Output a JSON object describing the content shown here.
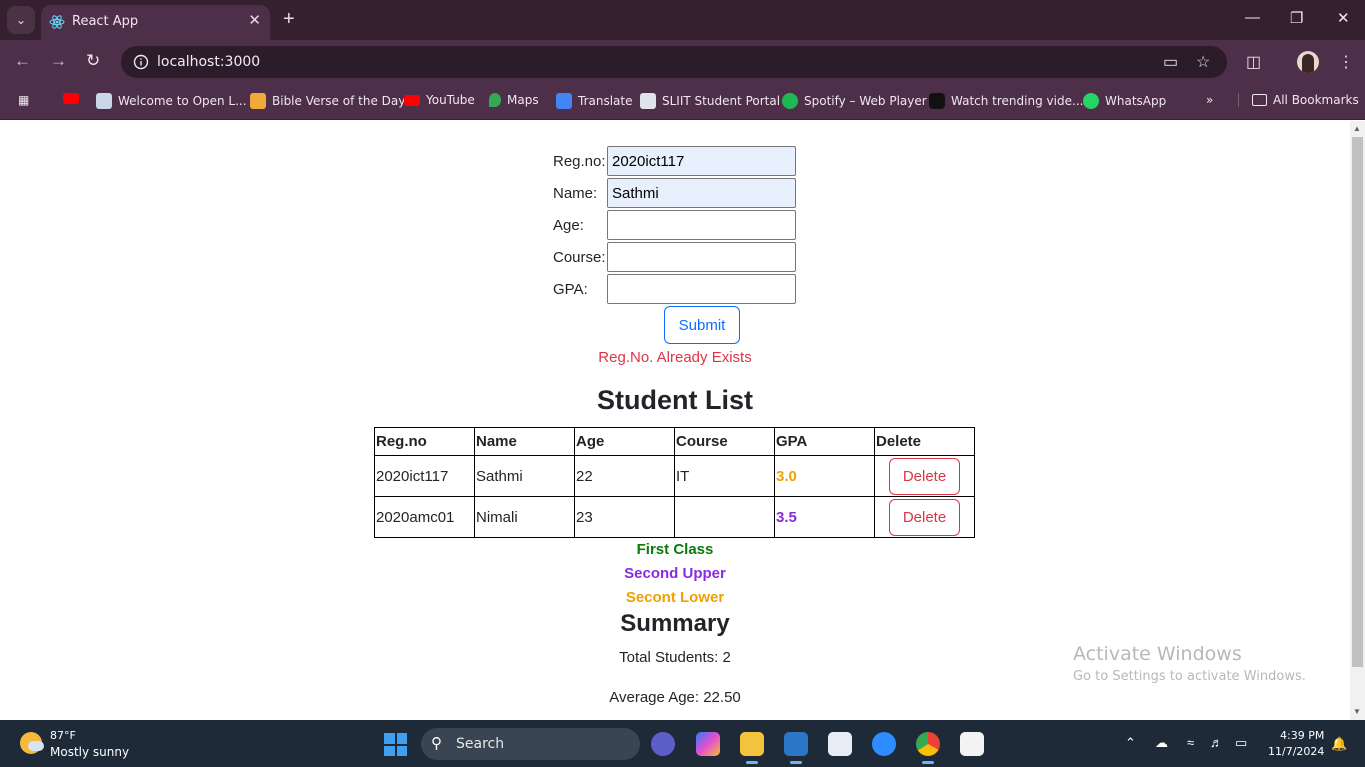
{
  "browser": {
    "tab_title": "React App",
    "url": "localhost:3000",
    "bookmarks": [
      "Welcome to Open L...",
      "Bible Verse of the Day",
      "YouTube",
      "Maps",
      "Translate",
      "SLIIT Student Portal",
      "Spotify – Web Player",
      "Watch trending vide...",
      "WhatsApp"
    ],
    "all_bookmarks": "All Bookmarks"
  },
  "form": {
    "regno_label": "Reg.no:",
    "regno_value": "2020ict117",
    "name_label": "Name:",
    "name_value": "Sathmi",
    "age_label": "Age:",
    "age_value": "",
    "course_label": "Course:",
    "course_value": "",
    "gpa_label": "GPA:",
    "gpa_value": "",
    "submit_label": "Submit",
    "error_message": "Reg.No. Already Exists"
  },
  "student_list": {
    "title": "Student List",
    "columns": [
      "Reg.no",
      "Name",
      "Age",
      "Course",
      "GPA",
      "Delete"
    ],
    "rows": [
      {
        "regno": "2020ict117",
        "name": "Sathmi",
        "age": "22",
        "course": "IT",
        "gpa": "3.0",
        "delete_label": "Delete"
      },
      {
        "regno": "2020amc01",
        "name": "Nimali",
        "age": "23",
        "course": "",
        "gpa": "3.5",
        "delete_label": "Delete"
      }
    ]
  },
  "legend": {
    "first_class": "First Class",
    "second_upper": "Second Upper",
    "second_lower": "Secont Lower"
  },
  "colors": {
    "first_class": "#0a7a0a",
    "second_upper": "#8a2be2",
    "second_lower": "#f0a000",
    "error": "#dc3545",
    "primary": "#0d6efd"
  },
  "summary": {
    "title": "Summary",
    "total_students": "Total Students: 2",
    "average_age": "Average Age: 22.50"
  },
  "watermark": {
    "line1": "Activate Windows",
    "line2": "Go to Settings to activate Windows."
  },
  "taskbar": {
    "temperature": "87°F",
    "weather": "Mostly sunny",
    "search_label": "Search",
    "time": "4:39 PM",
    "date": "11/7/2024"
  }
}
